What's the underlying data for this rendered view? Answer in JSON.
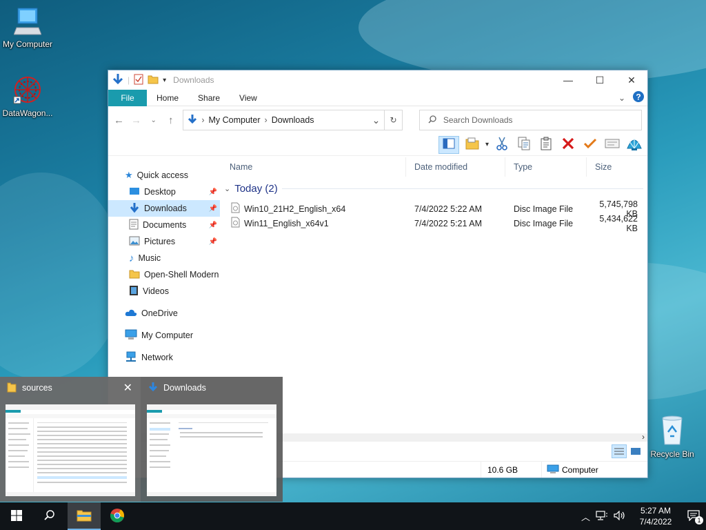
{
  "desktop": {
    "icons": [
      {
        "label": "My Computer",
        "icon": "computer-icon"
      },
      {
        "label": "DataWagon...",
        "icon": "datawagon-icon"
      },
      {
        "label": "Recycle Bin",
        "icon": "recycle-bin-icon"
      }
    ]
  },
  "window": {
    "title": "Downloads",
    "ribbon_tabs": [
      "File",
      "Home",
      "Share",
      "View"
    ],
    "breadcrumb": [
      "My Computer",
      "Downloads"
    ],
    "search_placeholder": "Search Downloads",
    "nav": {
      "quick_access": "Quick access",
      "items": [
        {
          "label": "Desktop",
          "pinned": true
        },
        {
          "label": "Downloads",
          "pinned": true,
          "selected": true
        },
        {
          "label": "Documents",
          "pinned": true
        },
        {
          "label": "Pictures",
          "pinned": true
        },
        {
          "label": "Music",
          "pinned": false
        },
        {
          "label": "Open-Shell Modern",
          "pinned": false
        },
        {
          "label": "Videos",
          "pinned": false
        }
      ],
      "onedrive": "OneDrive",
      "my_computer": "My Computer",
      "network": "Network"
    },
    "columns": {
      "name": "Name",
      "date": "Date modified",
      "type": "Type",
      "size": "Size"
    },
    "group_label": "Today (2)",
    "files": [
      {
        "name": "Win10_21H2_English_x64",
        "date": "7/4/2022 5:22 AM",
        "type": "Disc Image File",
        "size": "5,745,798 KB"
      },
      {
        "name": "Win11_English_x64v1",
        "date": "7/4/2022 5:21 AM",
        "type": "Disc Image File",
        "size": "5,434,622 KB"
      }
    ],
    "status": {
      "free_space": "10.6 GB",
      "location": "Computer"
    }
  },
  "thumbnails": [
    {
      "title": "sources",
      "icon": "folder-icon"
    },
    {
      "title": "Downloads",
      "icon": "download-arrow-icon"
    }
  ],
  "taskbar": {
    "time": "5:27 AM",
    "date": "7/4/2022",
    "notification_count": "1"
  },
  "colors": {
    "accent": "#1a9bad",
    "selection": "#cce8ff",
    "taskbar": "#101418"
  }
}
